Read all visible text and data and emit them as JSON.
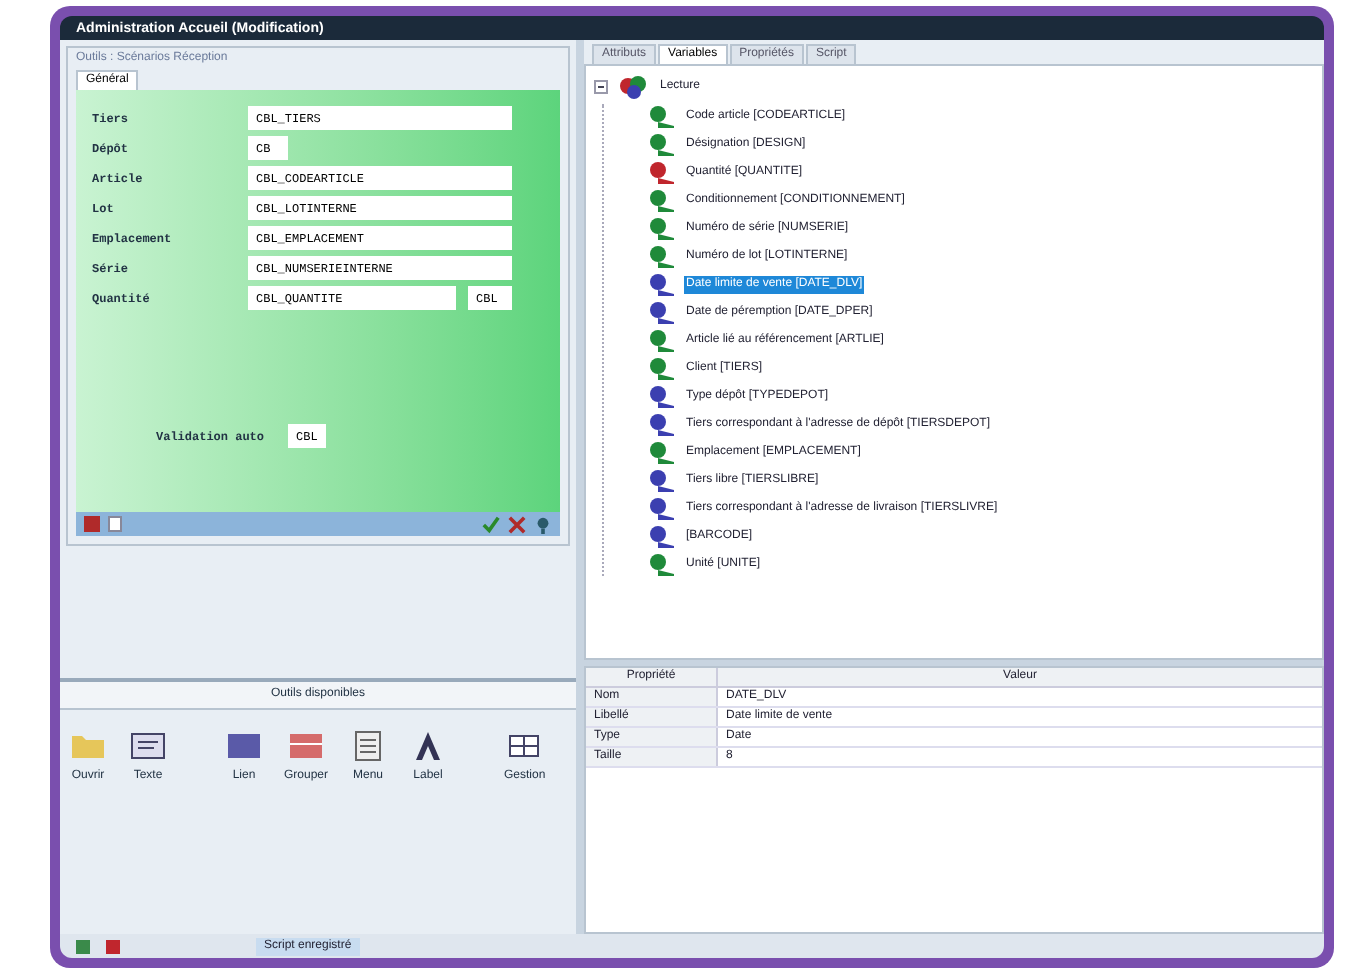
{
  "window": {
    "title": "Administration Accueil (Modification)"
  },
  "form_panel": {
    "title": "Outils : Scénarios Réception",
    "tab": "Général",
    "fields": [
      {
        "label": "Tiers",
        "value": "CBL_TIERS",
        "kind": "long"
      },
      {
        "label": "Dépôt",
        "value": "CB",
        "kind": "short"
      },
      {
        "label": "Article",
        "value": "CBL_CODEARTICLE",
        "kind": "long"
      },
      {
        "label": "Lot",
        "value": "CBL_LOTINTERNE",
        "kind": "long"
      },
      {
        "label": "Emplacement",
        "value": "CBL_EMPLACEMENT",
        "kind": "long"
      },
      {
        "label": "Série",
        "value": "CBL_NUMSERIEINTERNE",
        "kind": "long"
      },
      {
        "label": "Quantité",
        "value": "CBL_QUANTITE",
        "kind": "long",
        "extra": "CBL"
      }
    ],
    "validation": {
      "label": "Validation auto",
      "value": "CBL"
    }
  },
  "toolbox": {
    "title": "Outils disponibles",
    "tools": [
      {
        "label": "Ouvrir",
        "kind": "folder"
      },
      {
        "label": "Texte",
        "kind": "text"
      },
      {
        "label": "Lien",
        "kind": "link"
      },
      {
        "label": "Grouper",
        "kind": "group"
      },
      {
        "label": "Menu",
        "kind": "menu"
      },
      {
        "label": "Label",
        "kind": "label"
      },
      {
        "label": "Gestion",
        "kind": "grid"
      }
    ]
  },
  "status_bar": {
    "text": "Script enregistré"
  },
  "tabs": [
    {
      "label": "Attributs",
      "selected": false
    },
    {
      "label": "Variables",
      "selected": true
    },
    {
      "label": "Propriétés",
      "selected": false
    },
    {
      "label": "Script",
      "selected": false
    }
  ],
  "tree": {
    "label": "Lecture",
    "expanded": true,
    "children": [
      {
        "label": "Code article [CODEARTICLE]",
        "color": "#1f8a3a",
        "selected": false
      },
      {
        "label": "Désignation [DESIGN]",
        "color": "#1f8a3a",
        "selected": false
      },
      {
        "label": "Quantité [QUANTITE]",
        "color": "#c0262d",
        "selected": false
      },
      {
        "label": "Conditionnement [CONDITIONNEMENT]",
        "color": "#1f8a3a",
        "selected": false
      },
      {
        "label": "Numéro de série [NUMSERIE]",
        "color": "#1f8a3a",
        "selected": false
      },
      {
        "label": "Numéro de lot [LOTINTERNE]",
        "color": "#1f8a3a",
        "selected": false
      },
      {
        "label": "Date limite de vente [DATE_DLV]",
        "color": "#3b3fb0",
        "selected": true
      },
      {
        "label": "Date de péremption [DATE_DPER]",
        "color": "#3b3fb0",
        "selected": false
      },
      {
        "label": "Article lié au référencement [ARTLIE]",
        "color": "#1f8a3a",
        "selected": false
      },
      {
        "label": "Client [TIERS]",
        "color": "#1f8a3a",
        "selected": false
      },
      {
        "label": "Type dépôt [TYPEDEPOT]",
        "color": "#3b3fb0",
        "selected": false
      },
      {
        "label": "Tiers correspondant à l'adresse de dépôt [TIERSDEPOT]",
        "color": "#3b3fb0",
        "selected": false
      },
      {
        "label": "Emplacement [EMPLACEMENT]",
        "color": "#1f8a3a",
        "selected": false
      },
      {
        "label": "Tiers libre [TIERSLIBRE]",
        "color": "#3b3fb0",
        "selected": false
      },
      {
        "label": "Tiers correspondant à l'adresse de livraison [TIERSLIVRE]",
        "color": "#3b3fb0",
        "selected": false
      },
      {
        "label": "[BARCODE]",
        "color": "#3b3fb0",
        "selected": false
      },
      {
        "label": "Unité [UNITE]",
        "color": "#1f8a3a",
        "selected": false
      }
    ]
  },
  "properties": {
    "columns": [
      "Propriété",
      "Valeur"
    ],
    "rows": [
      {
        "name": "Nom",
        "value": "DATE_DLV"
      },
      {
        "name": "Libellé",
        "value": "Date limite de vente"
      },
      {
        "name": "Type",
        "value": "Date"
      },
      {
        "name": "Taille",
        "value": "8"
      }
    ]
  }
}
